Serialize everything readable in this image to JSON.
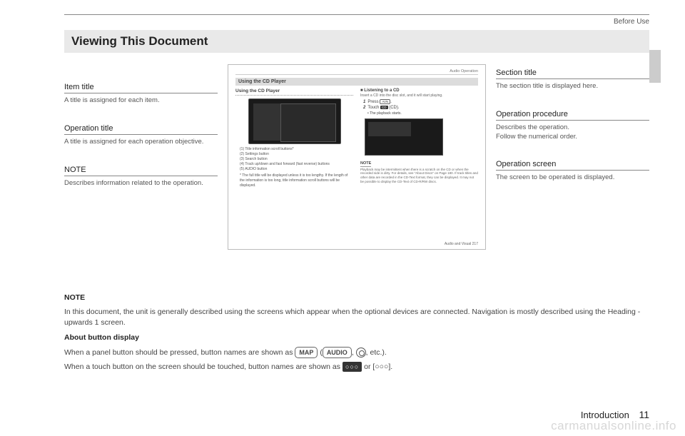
{
  "header": {
    "right": "Before Use"
  },
  "chapter_title": "Viewing This Document",
  "left_callouts": [
    {
      "title": "Item title",
      "desc": "A title is assigned for each item."
    },
    {
      "title": "Operation title",
      "desc": "A title is assigned for each operation objective."
    },
    {
      "title": "NOTE",
      "desc": "Describes information related to the operation."
    }
  ],
  "right_callouts": [
    {
      "title": "Section title",
      "desc": "The section title is displayed here."
    },
    {
      "title": "Operation procedure",
      "desc": "Describes the operation.\nFollow the numerical order."
    },
    {
      "title": "Operation screen",
      "desc": "The screen to be operated is displayed."
    }
  ],
  "sample": {
    "section": "Audio Operation",
    "item_title": "Using the CD Player",
    "op_title": "Using the CD Player",
    "listening": "Listening to a CD",
    "insert": "Insert a CD into the disc slot, and it will start playing.",
    "step1_pre": "Press",
    "step1_btn": "AVN",
    "step2_pre": "Touch",
    "step2_icon": "CD",
    "step2_post": "(CD).",
    "bullet": "The playback starts.",
    "list": [
      "(1)   Title information scroll buttons*",
      "(2)   Settings button",
      "(3)   Search button",
      "(4)   Track up/down and fast forward (fast reverse) buttons",
      "(5)   AUDIO button"
    ],
    "list_note": "*   The full title will be displayed unless it is too lengthy. If the length of the information is too long, title information scroll buttons will be displayed.",
    "note_label": "NOTE",
    "note_text": "Playback may be intermittent when there is a scratch on the CD or when the recorded side is dirty. For details, see \"About Discs\" on Page 180. If track titles and other data are recorded in the CD-Text format, they can be displayed. It may not be possible to display the CD-Text of CD-R/RW discs.",
    "footer": "Audio and Visual   217"
  },
  "bottom": {
    "note_label": "NOTE",
    "para1": "In this document, the unit is generally described using the screens which appear when the optional devices are connected. Navigation is mostly described using the Heading - upwards 1 screen.",
    "about": "About button display",
    "panel_pre": "When a panel button should be pressed, button names are shown as ",
    "btn_map": "MAP",
    "paren_open": "(",
    "btn_audio": "AUDIO",
    "comma": ", ",
    "etc": ", etc.).",
    "touch_pre": "When a touch button on the screen should be touched, button names are shown as ",
    "solid": "○○○",
    "or": " or [",
    "bracket": "○○○",
    "close": "]."
  },
  "footer": {
    "section": "Introduction",
    "page": "11"
  },
  "watermark": "carmanualsonline.info"
}
